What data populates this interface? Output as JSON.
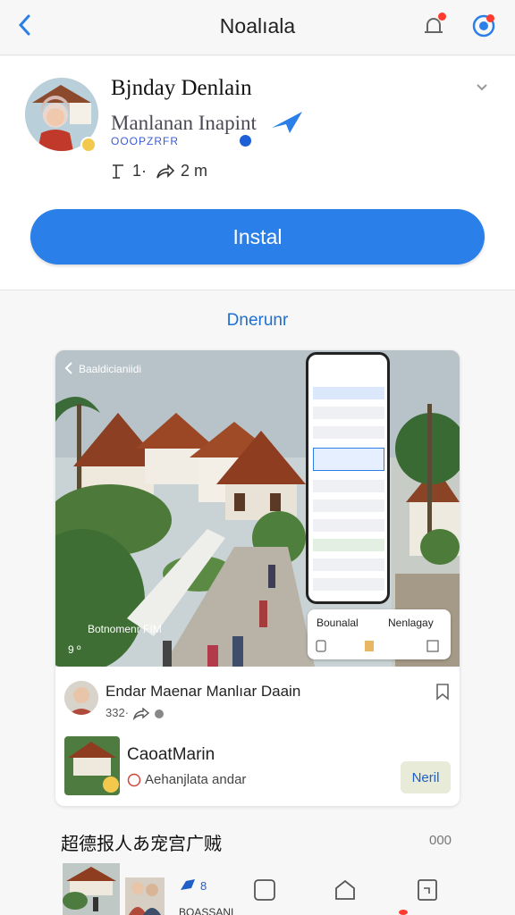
{
  "header": {
    "title": "Noalıala"
  },
  "app": {
    "name": "Bjnday Denlain",
    "developer": "Manlanan Inapint",
    "developer_sub": "OOOPZRFR",
    "stat_reviews": "1·",
    "stat_share": "2 m",
    "install_label": "Instal"
  },
  "section": {
    "label": "Dnerunr"
  },
  "feature": {
    "caption_top": "Baaldicianiidi",
    "caption_bottom": "Botnomenr FIM",
    "caption_icons": "9 º",
    "popup_left": "Bounalal",
    "popup_right": "Nenlagay",
    "post_title": "Endar Maenar Manlıar Daain",
    "post_meta": "332·",
    "mini_title": "CaoatMarin",
    "mini_sub": "Aehanjlata andar",
    "mini_button": "Neril"
  },
  "trending": {
    "title": "超德报人あ宠宫广贼",
    "more": "000"
  },
  "bottom": {
    "badge_count": "8",
    "label": "BOASSANI"
  },
  "colors": {
    "accent": "#2b7fe8",
    "link": "#1f6fd1",
    "badge": "#ff3b30"
  }
}
